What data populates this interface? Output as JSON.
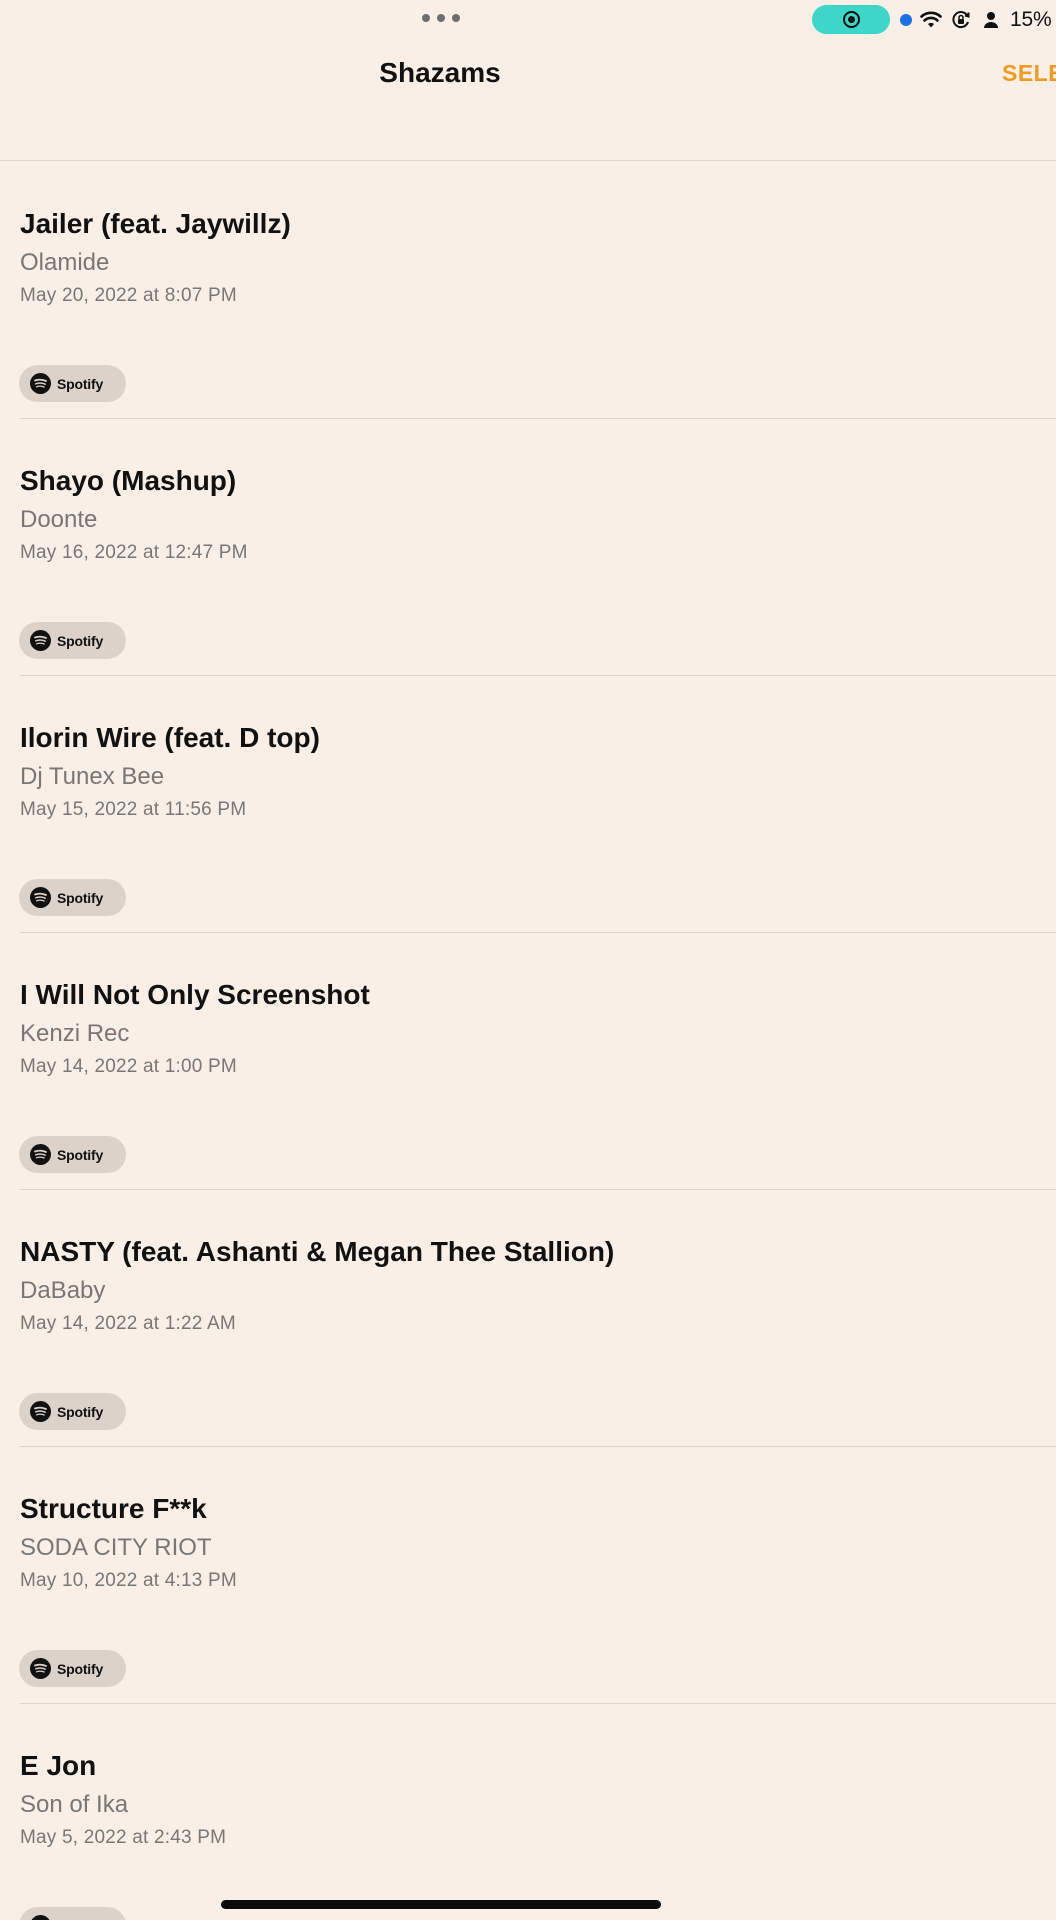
{
  "status_bar": {
    "battery_percent": "15%",
    "icons": [
      "more-dots-icon",
      "screen-record-icon",
      "location-dot-icon",
      "wifi-icon",
      "orientation-lock-icon",
      "person-icon",
      "battery-icon"
    ]
  },
  "header": {
    "title": "Shazams",
    "select_label": "SELE"
  },
  "items": [
    {
      "title": "Jailer (feat. Jaywillz)",
      "artist": "Olamide",
      "date": "May 20, 2022 at 8:07 PM",
      "service": "Spotify"
    },
    {
      "title": "Shayo (Mashup)",
      "artist": "Doonte",
      "date": "May 16, 2022 at 12:47 PM",
      "service": "Spotify"
    },
    {
      "title": "Ilorin Wire (feat. D top)",
      "artist": "Dj Tunex Bee",
      "date": "May 15, 2022 at 11:56 PM",
      "service": "Spotify"
    },
    {
      "title": "I Will Not Only Screenshot",
      "artist": "Kenzi Rec",
      "date": "May 14, 2022 at 1:00 PM",
      "service": "Spotify"
    },
    {
      "title": "NASTY (feat. Ashanti & Megan Thee Stallion)",
      "artist": "DaBaby",
      "date": "May 14, 2022 at 1:22 AM",
      "service": "Spotify"
    },
    {
      "title": "Structure F**k",
      "artist": "SODA CITY RIOT",
      "date": "May 10, 2022 at 4:13 PM",
      "service": "Spotify"
    },
    {
      "title": "E Jon",
      "artist": "Son of Ika",
      "date": "May 5, 2022 at 2:43 PM",
      "service": "Spotify"
    }
  ],
  "colors": {
    "background": "#f9efe6",
    "accent": "#ee9b25",
    "record_pill": "#3ed6c8",
    "secondary_text": "#7a7673",
    "spotify_pill": "#dcd2c9"
  }
}
